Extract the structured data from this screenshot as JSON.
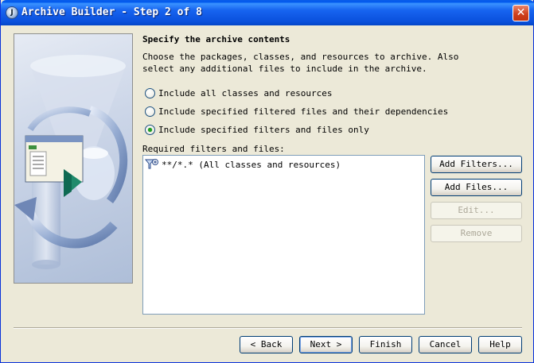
{
  "window": {
    "title": "Archive Builder - Step 2 of 8",
    "app_icon": "jdeveloper-app-icon",
    "close_glyph": "✕"
  },
  "content": {
    "heading": "Specify the archive contents",
    "description": "Choose the packages, classes, and resources to archive. Also select any additional files to include in the archive.",
    "options": [
      {
        "label": "Include all classes and resources",
        "checked": false
      },
      {
        "label": "Include specified filtered files and their dependencies",
        "checked": false
      },
      {
        "label": "Include specified filters and files only",
        "checked": true
      }
    ],
    "list_label": "Required filters and files:",
    "list_items": [
      {
        "text": "**/*.* (All classes and resources)",
        "icon": "filter-icon"
      }
    ]
  },
  "side_buttons": {
    "add_filters": "Add Filters...",
    "add_files": "Add Files...",
    "edit": "Edit...",
    "remove": "Remove"
  },
  "footer": {
    "back": "< Back",
    "next": "Next >",
    "finish": "Finish",
    "cancel": "Cancel",
    "help": "Help"
  },
  "colors": {
    "titlebar": "#0058ee",
    "dialog_bg": "#ece9d8",
    "radio_dot": "#21a121",
    "list_border": "#7f9db9"
  }
}
